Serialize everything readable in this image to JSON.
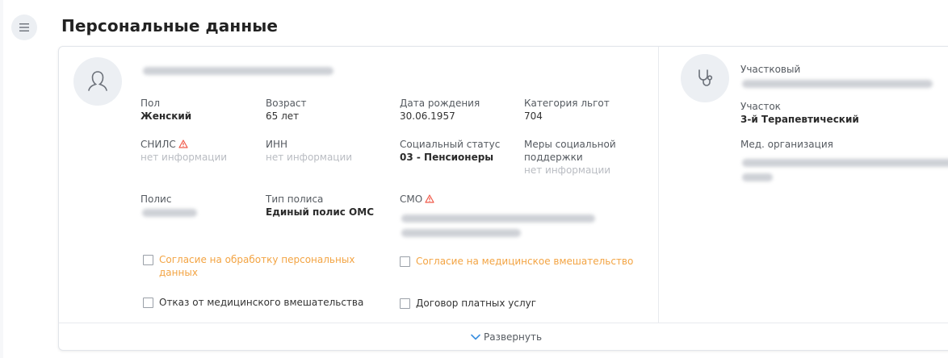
{
  "header": {
    "title": "Персональные данные"
  },
  "patient": {
    "fields": {
      "sex": {
        "label": "Пол",
        "value": "Женский"
      },
      "age": {
        "label": "Возраст",
        "value": "65 лет"
      },
      "birth_date": {
        "label": "Дата рождения",
        "value": "30.06.1957"
      },
      "benefit_category": {
        "label": "Категория льгот",
        "value": "704"
      },
      "snils": {
        "label": "СНИЛС",
        "value": "нет информации"
      },
      "inn": {
        "label": "ИНН",
        "value": "нет информации"
      },
      "social_status": {
        "label": "Социальный статус",
        "value": "03 - Пенсионеры"
      },
      "social_support": {
        "label_line1": "Меры социальной",
        "label_line2": "поддержки",
        "value": "нет информации"
      },
      "policy": {
        "label": "Полис"
      },
      "policy_type": {
        "label": "Тип полиса",
        "value": "Единый полис ОМС"
      },
      "smo": {
        "label": "СМО"
      }
    },
    "checkboxes": {
      "consent_personal_line1": "Согласие на обработку персональных",
      "consent_personal_line2": "данных",
      "consent_medical": "Согласие на медицинское вмешательство",
      "refusal_medical": "Отказ от медицинского вмешательства",
      "paid_contract": "Договор платных услуг"
    }
  },
  "right_panel": {
    "doctor_label": "Участковый",
    "district_label": "Участок",
    "district_value": "3-й Терапевтический",
    "org_label": "Мед. организация"
  },
  "footer": {
    "expand_label": "Развернуть"
  },
  "colors": {
    "warning": "#f05a4a",
    "consent_orange": "#f3a443",
    "expand_chevron": "#3b8fe0"
  },
  "icons": [
    "menu-icon",
    "person-icon",
    "stethoscope-icon",
    "warning-triangle-icon",
    "chevron-down-icon"
  ]
}
